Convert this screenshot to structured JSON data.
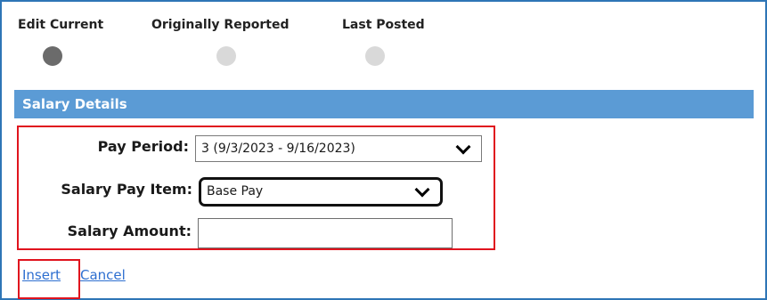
{
  "mode_tabs": [
    {
      "label": "Edit Current",
      "selected": true
    },
    {
      "label": "Originally Reported",
      "selected": false
    },
    {
      "label": "Last Posted",
      "selected": false
    }
  ],
  "section": {
    "title": "Salary Details"
  },
  "form": {
    "pay_period": {
      "label": "Pay Period:",
      "value": "3 (9/3/2023 - 9/16/2023)"
    },
    "salary_pay_item": {
      "label": "Salary Pay Item:",
      "value": "Base Pay"
    },
    "salary_amount": {
      "label": "Salary Amount:",
      "value": "",
      "placeholder": ""
    }
  },
  "actions": {
    "insert_label": "Insert",
    "cancel_label": "Cancel"
  },
  "colors": {
    "section_header_bg": "#5b9bd5",
    "highlight_border": "#e0141e",
    "link": "#2e6fd0",
    "selected_dot": "#6b6b6b",
    "unselected_dot": "#d9d9d9"
  },
  "icons": {
    "select_arrow": "chevron-down-icon"
  }
}
